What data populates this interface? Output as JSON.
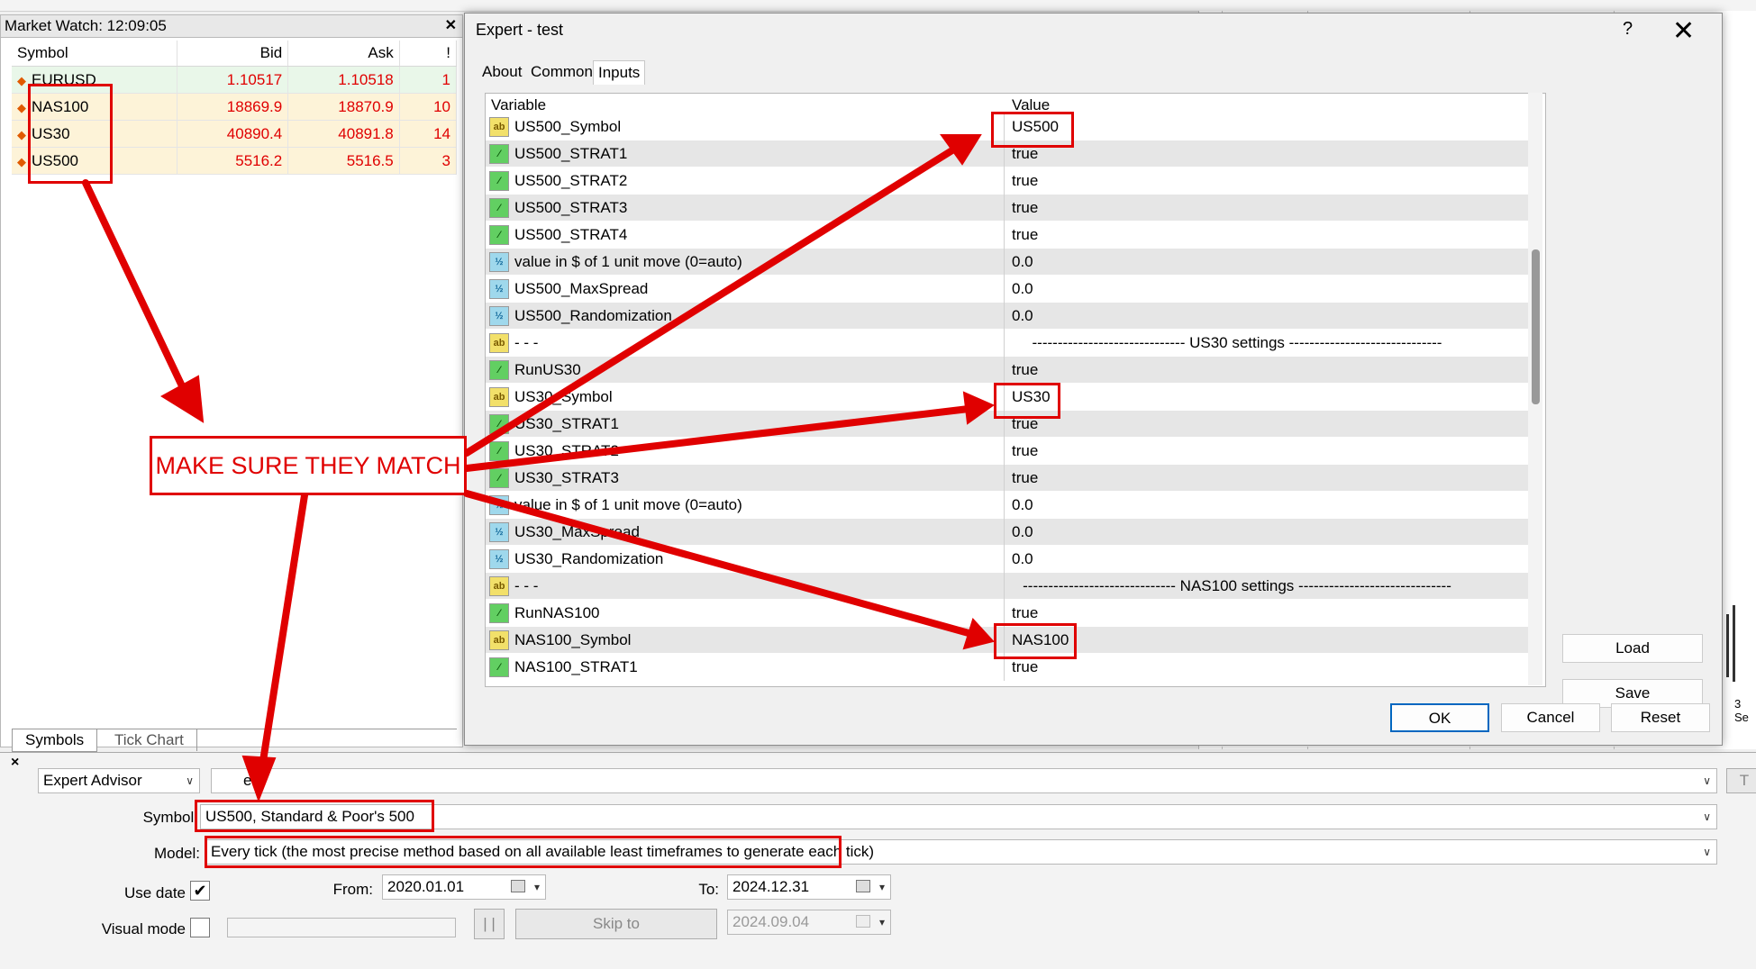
{
  "market_watch": {
    "title": "Market Watch: 12:09:05",
    "columns": [
      "Symbol",
      "Bid",
      "Ask",
      "!"
    ],
    "rows": [
      {
        "symbol": "EURUSD",
        "bid": "1.10517",
        "ask": "1.10518",
        "spread": "1"
      },
      {
        "symbol": "NAS100",
        "bid": "18869.9",
        "ask": "18870.9",
        "spread": "10"
      },
      {
        "symbol": "US30",
        "bid": "40890.4",
        "ask": "40891.8",
        "spread": "14"
      },
      {
        "symbol": "US500",
        "bid": "5516.2",
        "ask": "5516.5",
        "spread": "3"
      }
    ],
    "tabs": [
      "Symbols",
      "Tick Chart"
    ]
  },
  "dialog": {
    "title": "Expert - test",
    "help": "?",
    "close": "✕",
    "tabs": [
      "About",
      "Common",
      "Inputs"
    ],
    "active_tab": "Inputs",
    "columns": {
      "variable": "Variable",
      "value": "Value"
    },
    "rows": [
      {
        "type": "ab",
        "variable": "US500_Symbol",
        "value": "US500"
      },
      {
        "type": "bool",
        "variable": "US500_STRAT1",
        "value": "true"
      },
      {
        "type": "bool",
        "variable": "US500_STRAT2",
        "value": "true"
      },
      {
        "type": "bool",
        "variable": "US500_STRAT3",
        "value": "true"
      },
      {
        "type": "bool",
        "variable": "US500_STRAT4",
        "value": "true"
      },
      {
        "type": "dbl",
        "variable": "value in $ of 1 unit move (0=auto)",
        "value": "0.0"
      },
      {
        "type": "dbl",
        "variable": "US500_MaxSpread",
        "value": "0.0"
      },
      {
        "type": "dbl",
        "variable": "US500_Randomization",
        "value": "0.0"
      },
      {
        "type": "ab",
        "variable": "- - -",
        "value": "------------------------------ US30 settings ------------------------------"
      },
      {
        "type": "bool",
        "variable": "RunUS30",
        "value": "true"
      },
      {
        "type": "ab",
        "variable": "US30_Symbol",
        "value": "US30"
      },
      {
        "type": "bool",
        "variable": "US30_STRAT1",
        "value": "true"
      },
      {
        "type": "bool",
        "variable": "US30_STRAT2",
        "value": "true"
      },
      {
        "type": "bool",
        "variable": "US30_STRAT3",
        "value": "true"
      },
      {
        "type": "dbl",
        "variable": "value in $ of 1 unit move (0=auto)",
        "value": "0.0"
      },
      {
        "type": "dbl",
        "variable": "US30_MaxSpread",
        "value": "0.0"
      },
      {
        "type": "dbl",
        "variable": "US30_Randomization",
        "value": "0.0"
      },
      {
        "type": "ab",
        "variable": "- - -",
        "value": "------------------------------ NAS100 settings ------------------------------"
      },
      {
        "type": "bool",
        "variable": "RunNAS100",
        "value": "true"
      },
      {
        "type": "ab",
        "variable": "NAS100_Symbol",
        "value": "NAS100"
      },
      {
        "type": "bool",
        "variable": "NAS100_STRAT1",
        "value": "true"
      }
    ],
    "icon_labels": {
      "ab": "ab",
      "bool": "⁄",
      "dbl": "½"
    },
    "buttons": {
      "load": "Load",
      "save": "Save",
      "ok": "OK",
      "cancel": "Cancel",
      "reset": "Reset"
    }
  },
  "tester": {
    "close": "×",
    "type": "Expert Advisor",
    "ea_name": "ea",
    "symbol_label": "Symbol:",
    "symbol_value": "US500, Standard & Poor's 500",
    "model_label": "Model:",
    "model_value": "Every tick (the most precise method based on all available least timeframes to generate each tick)",
    "use_date_label": "Use date",
    "use_date_checked": "✔",
    "from_label": "From:",
    "from_value": "2020.01.01",
    "to_label": "To:",
    "to_value": "2024.12.31",
    "visual_mode_label": "Visual mode",
    "pause_label": "| |",
    "skip_to_label": "Skip to",
    "skip_to_value": "2024.09.04",
    "right_button": "T"
  },
  "chart": {
    "axis_label": "3 Se"
  },
  "annotation": {
    "callout": "MAKE SURE THEY MATCH"
  },
  "colors": {
    "annotation": "#e00000",
    "price_red": "#e00000"
  },
  "icons": [
    "down-arrow-icon",
    "close-icon",
    "help-icon",
    "string-param-icon",
    "bool-param-icon",
    "double-param-icon",
    "calendar-icon",
    "dropdown-icon",
    "checkmark-icon"
  ]
}
